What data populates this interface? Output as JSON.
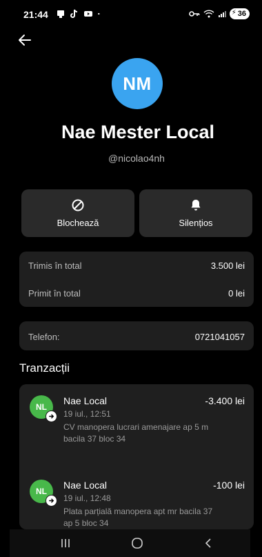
{
  "status_bar": {
    "time": "21:44",
    "battery": "36",
    "icons_left": [
      "notification-icon",
      "tiktok-icon",
      "youtube-icon",
      "dot-icon"
    ],
    "icons_right": [
      "vpn-key-icon",
      "wifi-icon",
      "signal-icon",
      "battery-icon"
    ]
  },
  "profile": {
    "initials": "NM",
    "avatar_color": "#3aa4f0",
    "name": "Nae Mester Local",
    "handle": "@nicolao4nh"
  },
  "actions": {
    "block_label": "Blochează",
    "silence_label": "Silențios"
  },
  "totals": {
    "sent_label": "Trimis în total",
    "sent_value": "3.500 lei",
    "received_label": "Primit în total",
    "received_value": "0 lei"
  },
  "phone": {
    "label": "Telefon:",
    "value": "0721041057"
  },
  "transactions": {
    "heading": "Tranzacții",
    "items": [
      {
        "initials": "NL",
        "name": "Nae Local",
        "amount": "-3.400 lei",
        "date": "19 iul., 12:51",
        "description": "CV manopera lucrari amenajare ap 5 m bacila 37 bloc 34"
      },
      {
        "initials": "NL",
        "name": "Nae Local",
        "amount": "-100 lei",
        "date": "19 iul., 12:48",
        "description": "Plata parțială manopera apt mr bacila 37 ap 5 bloc 34"
      }
    ]
  },
  "colors": {
    "background": "#000000",
    "card": "#1f1f1f",
    "button": "#2a2a2a",
    "tx_avatar": "#48b84a"
  }
}
